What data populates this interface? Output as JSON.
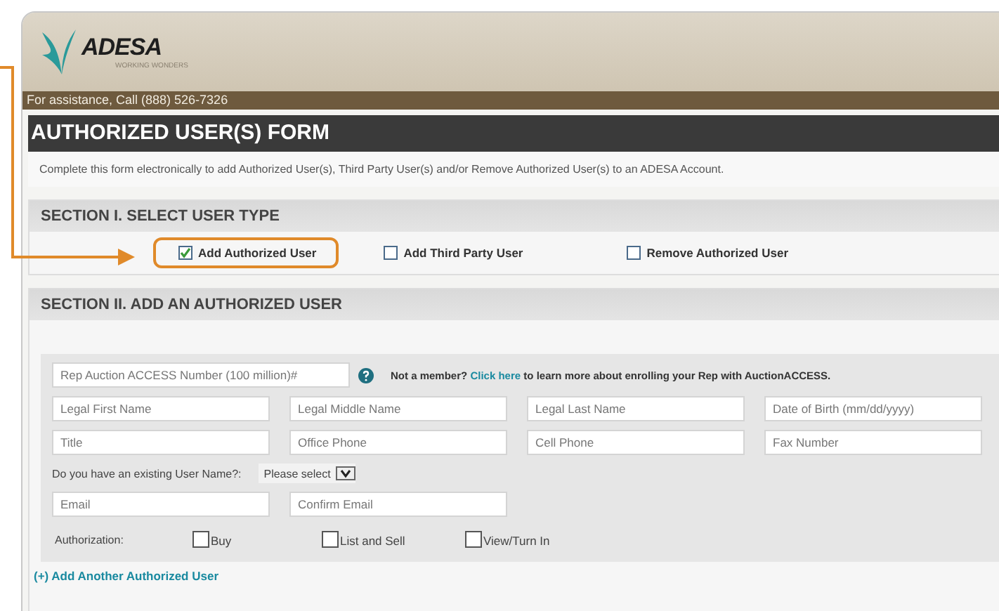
{
  "header": {
    "logo": "ADESA",
    "tagline": "WORKING WONDERS"
  },
  "assistance": "For assistance, Call (888) 526-7326",
  "title": "AUTHORIZED USER(S) FORM",
  "intro": "Complete this form electronically to add Authorized User(s), Third Party User(s) and/or Remove Authorized User(s) to an ADESA Account.",
  "section_1": {
    "heading": "SECTION I. SELECT USER TYPE",
    "options": [
      {
        "label": "Add Authorized User",
        "checked": true,
        "highlighted": true
      },
      {
        "label": "Add Third Party User",
        "checked": false,
        "highlighted": false
      },
      {
        "label": "Remove Authorized User",
        "checked": false,
        "highlighted": false
      }
    ]
  },
  "section_2": {
    "heading": "SECTION II. ADD AN AUTHORIZED USER",
    "rep_number": {
      "placeholder": "Rep Auction ACCESS Number (100 million)#"
    },
    "help_text": {
      "before": "Not a member?",
      "link": "Click here",
      "after": "to learn more about enrolling your Rep with AuctionACCESS."
    },
    "field_rows": [
      [
        {
          "placeholder": "Legal First Name"
        },
        {
          "placeholder": "Legal Middle Name"
        },
        {
          "placeholder": "Legal Last Name"
        },
        {
          "placeholder": "Date of Birth (mm/dd/yyyy)"
        }
      ],
      [
        {
          "placeholder": "Title"
        },
        {
          "placeholder": "Office Phone"
        },
        {
          "placeholder": "Cell Phone"
        },
        {
          "placeholder": "Fax Number"
        }
      ]
    ],
    "username_question": {
      "label": "Do you have an existing User Name?:",
      "value": "Please select"
    },
    "email_row": [
      {
        "placeholder": "Email"
      },
      {
        "placeholder": "Confirm Email"
      }
    ],
    "authorization": {
      "label": "Authorization:",
      "options": [
        {
          "label": "Buy",
          "checked": false
        },
        {
          "label": "List and Sell",
          "checked": false
        },
        {
          "label": "View/Turn In",
          "checked": false
        }
      ]
    },
    "add_another": "(+) Add Another Authorized User"
  }
}
